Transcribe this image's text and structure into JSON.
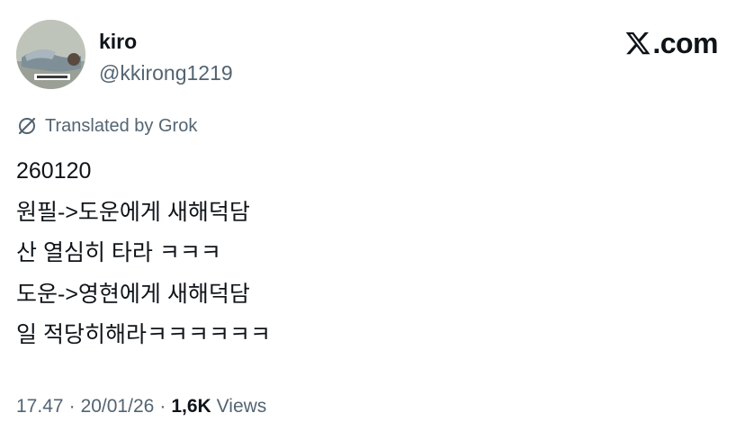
{
  "author": {
    "display_name": "kiro",
    "handle": "@kkirong1219",
    "avatar_icon": "profile-photo"
  },
  "brand": {
    "logo_text": ".com",
    "logo_icon": "x-logo-icon"
  },
  "translation": {
    "label": "Translated by Grok",
    "icon": "grok-icon"
  },
  "tweet": {
    "lines": [
      "260120",
      "원필->도운에게 새해덕담",
      "산 열심히 타라 ㅋㅋㅋ",
      "도운->영현에게 새해덕담",
      "일 적당히해라ㅋㅋㅋㅋㅋㅋ"
    ]
  },
  "meta": {
    "time": "17.47",
    "date": "20/01/26",
    "separator": "·",
    "views_count": "1,6K",
    "views_label": "Views"
  },
  "colors": {
    "text": "#0f1419",
    "secondary": "#536471",
    "background": "#ffffff"
  }
}
